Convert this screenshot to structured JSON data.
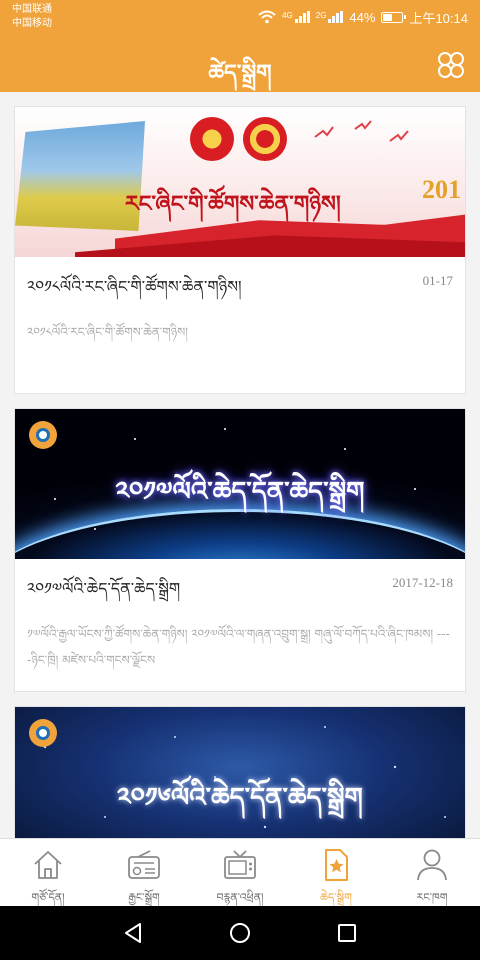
{
  "status_bar": {
    "carrier_1": "中国联通",
    "carrier_2": "中国移动",
    "signal_1_tag": "4G",
    "signal_2_tag": "2G",
    "battery_percent": "44%",
    "time": "上午10:14"
  },
  "app_bar": {
    "title": "ཚེད་སྒྲིག",
    "menu_icon": "grid-menu-icon"
  },
  "feed": [
    {
      "banner_text": "རང་ཞིང་གི་ཚོགས་ཆེན་གཉིས།",
      "banner_year": "201",
      "title": "༢༠༡༨ལོའི་རང་ཞིང་གི་ཚོགས་ཆེན་གཉིས།",
      "date": "01-17",
      "summary": "༢༠༡༨ལོའི་རང་ཞིང་གི་ཚོགས་ཆེན་གཉིས།"
    },
    {
      "banner_text": "༢༠༡༧ལོའི་ཆེད་དོན་ཆེད་སྒྲིག",
      "title": "༢༠༡༧ལོའི་ཆེད་དོན་ཆེད་སྒྲིག",
      "date": "2017-12-18",
      "summary": "༡༧ལོའི་རྒྱལ་ཡོངས་ཀྱི་ཚོགས་ཆེན་གཉིས། ༢༠༡༧ལོའི་ལ་གཞན་འབྲུག་སྒྲ། གཞུ་ལོ་བཀོད་པའི་ཞིང་ཁམས། ----ཉིང་ཁྲི། མཛེས་པའི་གངས་ལྗོངས"
    },
    {
      "banner_text": "༢༠༡༦ལོའི་ཆེད་དོན་ཆེད་སྒྲིག"
    }
  ],
  "bottom_nav": {
    "active_index": 3,
    "items": [
      {
        "label": "གཙོ་དོན།",
        "icon": "home-icon"
      },
      {
        "label": "རྒྱང་སྒྲོག",
        "icon": "radio-icon"
      },
      {
        "label": "བརྙན་འཕྲིན།",
        "icon": "tv-icon"
      },
      {
        "label": "ཆེད་སྒྲིག",
        "icon": "star-bookmark-icon"
      },
      {
        "label": "རང་ཁག",
        "icon": "user-icon"
      }
    ]
  },
  "system_nav": {
    "back_icon": "back-triangle-icon",
    "home_icon": "home-circle-icon",
    "recents_icon": "recents-square-icon"
  },
  "colors": {
    "accent": "#f0a33a",
    "inactive_icon": "#8a8a8a",
    "date_text": "#888888",
    "summary_text": "#aaaaaa"
  }
}
